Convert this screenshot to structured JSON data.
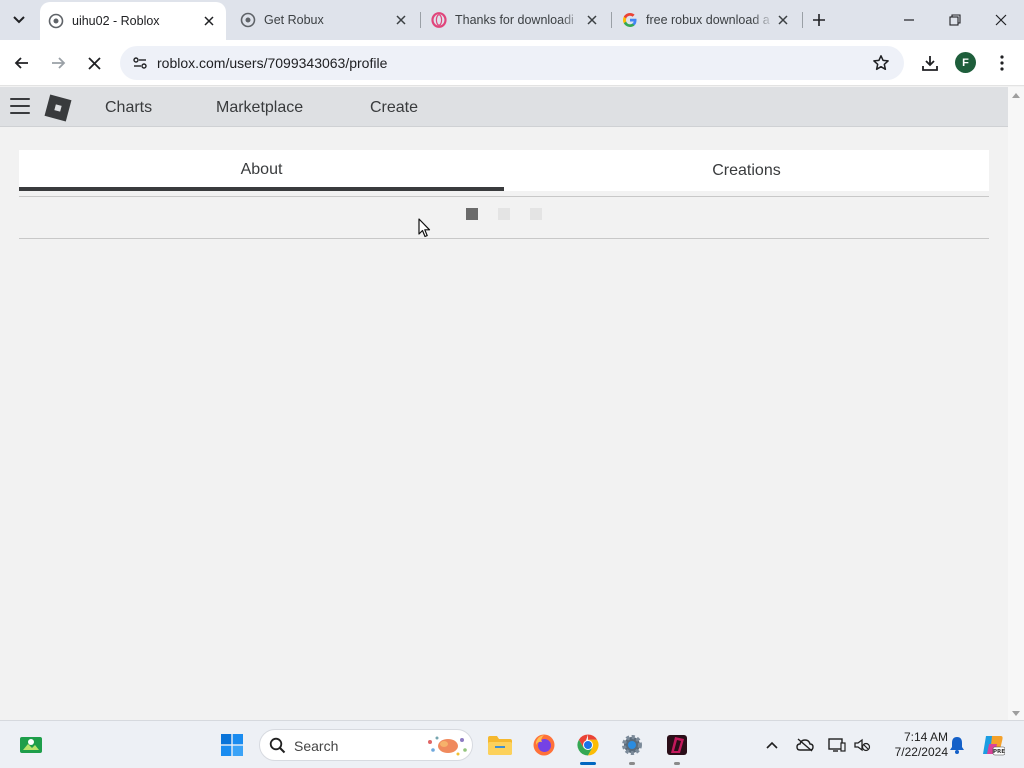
{
  "browser": {
    "tabs": [
      {
        "title": "uihu02 - Roblox",
        "active": true
      },
      {
        "title": "Get Robux",
        "active": false
      },
      {
        "title": "Thanks for downloadi",
        "active": false
      },
      {
        "title": "free robux download a",
        "active": false
      }
    ],
    "url": "roblox.com/users/7099343063/profile",
    "profile_initial": "F"
  },
  "roblox": {
    "nav": {
      "charts": "Charts",
      "marketplace": "Marketplace",
      "create": "Create"
    },
    "profile_tabs": {
      "about": "About",
      "creations": "Creations"
    }
  },
  "taskbar": {
    "search_label": "Search",
    "time": "7:14 AM",
    "date": "7/22/2024"
  },
  "colors": {
    "tab_strip": "#dfe3eb",
    "roblox_header": "#dee0e3",
    "page_background": "#f2f2f2",
    "taskbar": "#edf0f5",
    "tab_underline": "#393b3d"
  }
}
